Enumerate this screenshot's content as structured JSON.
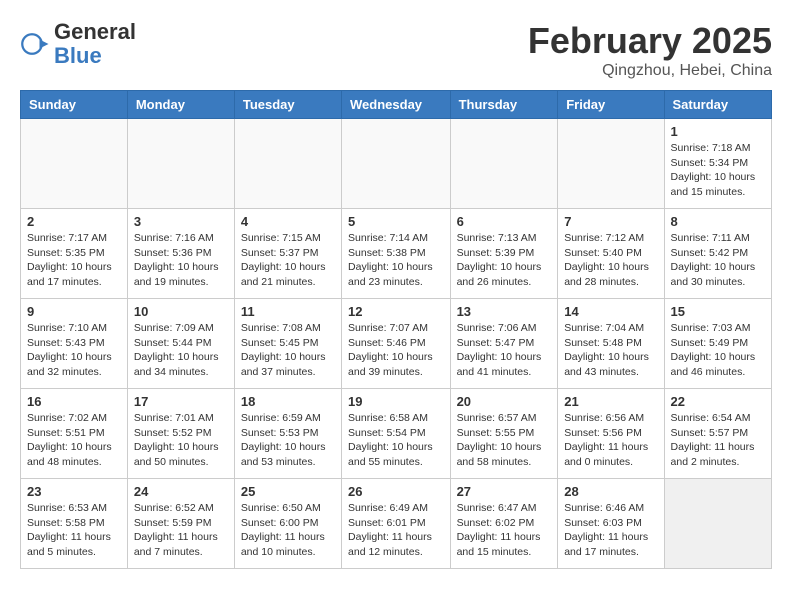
{
  "header": {
    "logo": {
      "general": "General",
      "blue": "Blue"
    },
    "month_title": "February 2025",
    "location": "Qingzhou, Hebei, China"
  },
  "days_of_week": [
    "Sunday",
    "Monday",
    "Tuesday",
    "Wednesday",
    "Thursday",
    "Friday",
    "Saturday"
  ],
  "weeks": [
    [
      {
        "day": "",
        "info": ""
      },
      {
        "day": "",
        "info": ""
      },
      {
        "day": "",
        "info": ""
      },
      {
        "day": "",
        "info": ""
      },
      {
        "day": "",
        "info": ""
      },
      {
        "day": "",
        "info": ""
      },
      {
        "day": "1",
        "info": "Sunrise: 7:18 AM\nSunset: 5:34 PM\nDaylight: 10 hours\nand 15 minutes."
      }
    ],
    [
      {
        "day": "2",
        "info": "Sunrise: 7:17 AM\nSunset: 5:35 PM\nDaylight: 10 hours\nand 17 minutes."
      },
      {
        "day": "3",
        "info": "Sunrise: 7:16 AM\nSunset: 5:36 PM\nDaylight: 10 hours\nand 19 minutes."
      },
      {
        "day": "4",
        "info": "Sunrise: 7:15 AM\nSunset: 5:37 PM\nDaylight: 10 hours\nand 21 minutes."
      },
      {
        "day": "5",
        "info": "Sunrise: 7:14 AM\nSunset: 5:38 PM\nDaylight: 10 hours\nand 23 minutes."
      },
      {
        "day": "6",
        "info": "Sunrise: 7:13 AM\nSunset: 5:39 PM\nDaylight: 10 hours\nand 26 minutes."
      },
      {
        "day": "7",
        "info": "Sunrise: 7:12 AM\nSunset: 5:40 PM\nDaylight: 10 hours\nand 28 minutes."
      },
      {
        "day": "8",
        "info": "Sunrise: 7:11 AM\nSunset: 5:42 PM\nDaylight: 10 hours\nand 30 minutes."
      }
    ],
    [
      {
        "day": "9",
        "info": "Sunrise: 7:10 AM\nSunset: 5:43 PM\nDaylight: 10 hours\nand 32 minutes."
      },
      {
        "day": "10",
        "info": "Sunrise: 7:09 AM\nSunset: 5:44 PM\nDaylight: 10 hours\nand 34 minutes."
      },
      {
        "day": "11",
        "info": "Sunrise: 7:08 AM\nSunset: 5:45 PM\nDaylight: 10 hours\nand 37 minutes."
      },
      {
        "day": "12",
        "info": "Sunrise: 7:07 AM\nSunset: 5:46 PM\nDaylight: 10 hours\nand 39 minutes."
      },
      {
        "day": "13",
        "info": "Sunrise: 7:06 AM\nSunset: 5:47 PM\nDaylight: 10 hours\nand 41 minutes."
      },
      {
        "day": "14",
        "info": "Sunrise: 7:04 AM\nSunset: 5:48 PM\nDaylight: 10 hours\nand 43 minutes."
      },
      {
        "day": "15",
        "info": "Sunrise: 7:03 AM\nSunset: 5:49 PM\nDaylight: 10 hours\nand 46 minutes."
      }
    ],
    [
      {
        "day": "16",
        "info": "Sunrise: 7:02 AM\nSunset: 5:51 PM\nDaylight: 10 hours\nand 48 minutes."
      },
      {
        "day": "17",
        "info": "Sunrise: 7:01 AM\nSunset: 5:52 PM\nDaylight: 10 hours\nand 50 minutes."
      },
      {
        "day": "18",
        "info": "Sunrise: 6:59 AM\nSunset: 5:53 PM\nDaylight: 10 hours\nand 53 minutes."
      },
      {
        "day": "19",
        "info": "Sunrise: 6:58 AM\nSunset: 5:54 PM\nDaylight: 10 hours\nand 55 minutes."
      },
      {
        "day": "20",
        "info": "Sunrise: 6:57 AM\nSunset: 5:55 PM\nDaylight: 10 hours\nand 58 minutes."
      },
      {
        "day": "21",
        "info": "Sunrise: 6:56 AM\nSunset: 5:56 PM\nDaylight: 11 hours\nand 0 minutes."
      },
      {
        "day": "22",
        "info": "Sunrise: 6:54 AM\nSunset: 5:57 PM\nDaylight: 11 hours\nand 2 minutes."
      }
    ],
    [
      {
        "day": "23",
        "info": "Sunrise: 6:53 AM\nSunset: 5:58 PM\nDaylight: 11 hours\nand 5 minutes."
      },
      {
        "day": "24",
        "info": "Sunrise: 6:52 AM\nSunset: 5:59 PM\nDaylight: 11 hours\nand 7 minutes."
      },
      {
        "day": "25",
        "info": "Sunrise: 6:50 AM\nSunset: 6:00 PM\nDaylight: 11 hours\nand 10 minutes."
      },
      {
        "day": "26",
        "info": "Sunrise: 6:49 AM\nSunset: 6:01 PM\nDaylight: 11 hours\nand 12 minutes."
      },
      {
        "day": "27",
        "info": "Sunrise: 6:47 AM\nSunset: 6:02 PM\nDaylight: 11 hours\nand 15 minutes."
      },
      {
        "day": "28",
        "info": "Sunrise: 6:46 AM\nSunset: 6:03 PM\nDaylight: 11 hours\nand 17 minutes."
      },
      {
        "day": "",
        "info": ""
      }
    ]
  ]
}
